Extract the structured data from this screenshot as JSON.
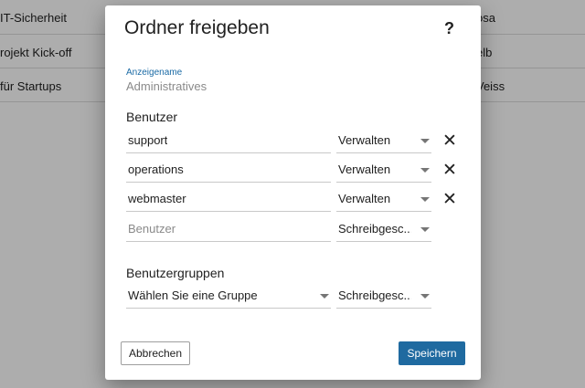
{
  "background": {
    "rows": [
      {
        "left": "IT-Sicherheit",
        "right": "osa"
      },
      {
        "left": "rojekt Kick-off",
        "right": "elb"
      },
      {
        "left": "für Startups",
        "right": "Veiss"
      }
    ]
  },
  "dialog": {
    "title": "Ordner freigeben",
    "help_label": "?",
    "display_name_label": "Anzeigename",
    "display_name_value": "Administratives",
    "users_heading": "Benutzer",
    "users": [
      {
        "name": "support",
        "permission": "Verwalten"
      },
      {
        "name": "operations",
        "permission": "Verwalten"
      },
      {
        "name": "webmaster",
        "permission": "Verwalten"
      }
    ],
    "new_user": {
      "placeholder": "Benutzer",
      "permission": "Schreibgesc..."
    },
    "groups_heading": "Benutzergruppen",
    "group_select": {
      "placeholder": "Wählen Sie eine Gruppe",
      "permission": "Schreibgesc..."
    },
    "remove_icon": "close-icon",
    "cancel_label": "Abbrechen",
    "save_label": "Speichern"
  },
  "colors": {
    "accent": "#1f6aa0",
    "label_blue": "#1a6aa5",
    "overlay": "rgba(0,0,0,0.32)"
  }
}
